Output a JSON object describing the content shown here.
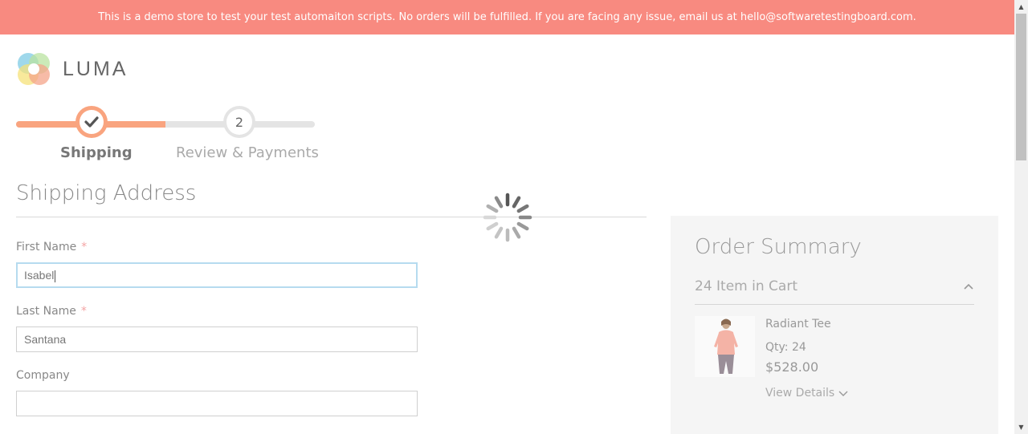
{
  "banner": {
    "text": "This is a demo store to test your test automaiton scripts. No orders will be fulfilled. If you are facing any issue, email us at hello@softwaretestingboard.com."
  },
  "logo": {
    "text": "LUMA",
    "icon": "luma-logo-icon"
  },
  "progress": {
    "steps": [
      {
        "label": "Shipping",
        "number": "1",
        "status": "completed",
        "icon": "checkmark-icon"
      },
      {
        "label": "Review & Payments",
        "number": "2",
        "status": "pending"
      }
    ]
  },
  "shipping": {
    "title": "Shipping Address",
    "required_marker": "*",
    "fields": {
      "first_name": {
        "label": "First Name",
        "value": "Isabel",
        "required": true
      },
      "last_name": {
        "label": "Last Name",
        "value": "Santana",
        "required": true
      },
      "company": {
        "label": "Company",
        "value": "",
        "required": false
      }
    }
  },
  "loading": {
    "icon": "loading-spinner-icon"
  },
  "order_summary": {
    "title": "Order Summary",
    "cart_count_text": "24 Item in Cart",
    "items": [
      {
        "name": "Radiant Tee",
        "qty_text": "Qty: 24",
        "price": "$528.00",
        "details_link": "View Details"
      }
    ]
  },
  "colors": {
    "banner_bg": "#f88a80",
    "progress_accent": "#f9a47f",
    "focus_border": "#b6dbef"
  }
}
